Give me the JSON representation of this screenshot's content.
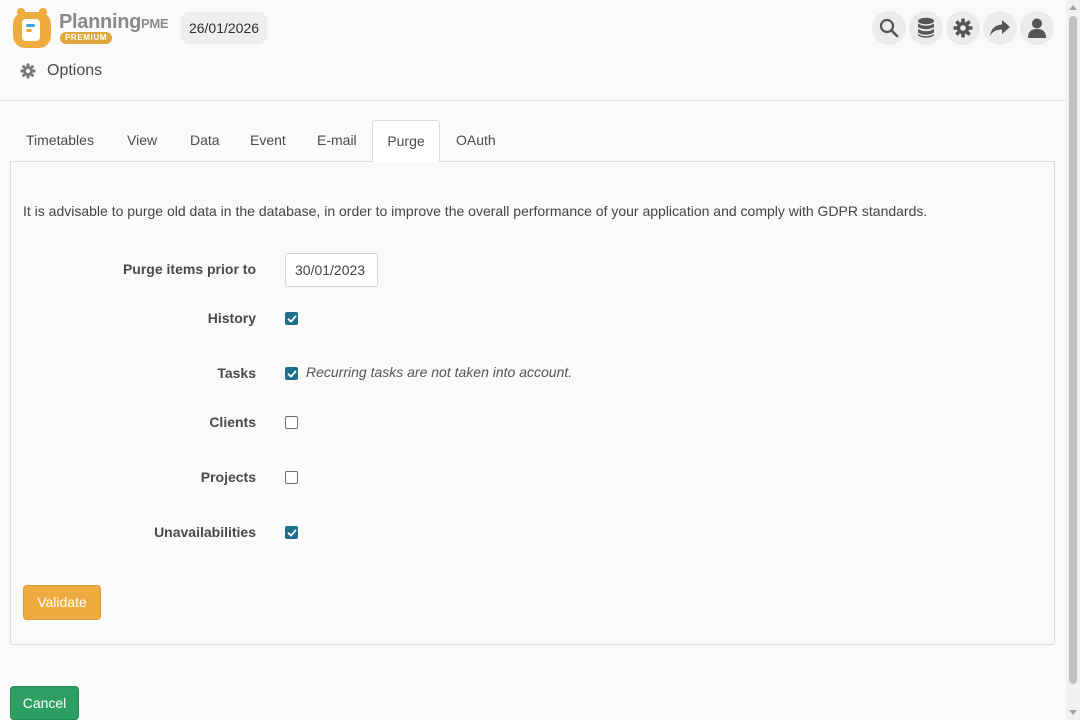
{
  "header": {
    "brand": "Planning",
    "brand_suffix": "PME",
    "badge": "PREMIUM",
    "date": "26/01/2026",
    "icons": [
      "search-icon",
      "database-icon",
      "gear-icon",
      "share-icon",
      "user-icon"
    ]
  },
  "breadcrumb": {
    "title": "Options",
    "icon": "gear-icon"
  },
  "tabs": [
    "Timetables",
    "View",
    "Data",
    "Event",
    "E-mail",
    "Purge",
    "OAuth"
  ],
  "active_tab": "Purge",
  "purge": {
    "intro": "It is advisable to purge old data in the database, in order to improve the overall performance of your application and comply with GDPR standards.",
    "prior_label": "Purge items prior to",
    "prior_value": "30/01/2023",
    "options": [
      {
        "label": "History",
        "checked": true
      },
      {
        "label": "Tasks",
        "checked": true,
        "note": "Recurring tasks are not taken into account."
      },
      {
        "label": "Clients",
        "checked": false
      },
      {
        "label": "Projects",
        "checked": false
      },
      {
        "label": "Unavailabilities",
        "checked": true
      }
    ],
    "validate_label": "Validate"
  },
  "cancel_label": "Cancel",
  "colors": {
    "accent": "#eeab3f",
    "checkbox": "#1f6f8b",
    "cancel": "#2e9f63",
    "logo": "#eeab3f"
  }
}
